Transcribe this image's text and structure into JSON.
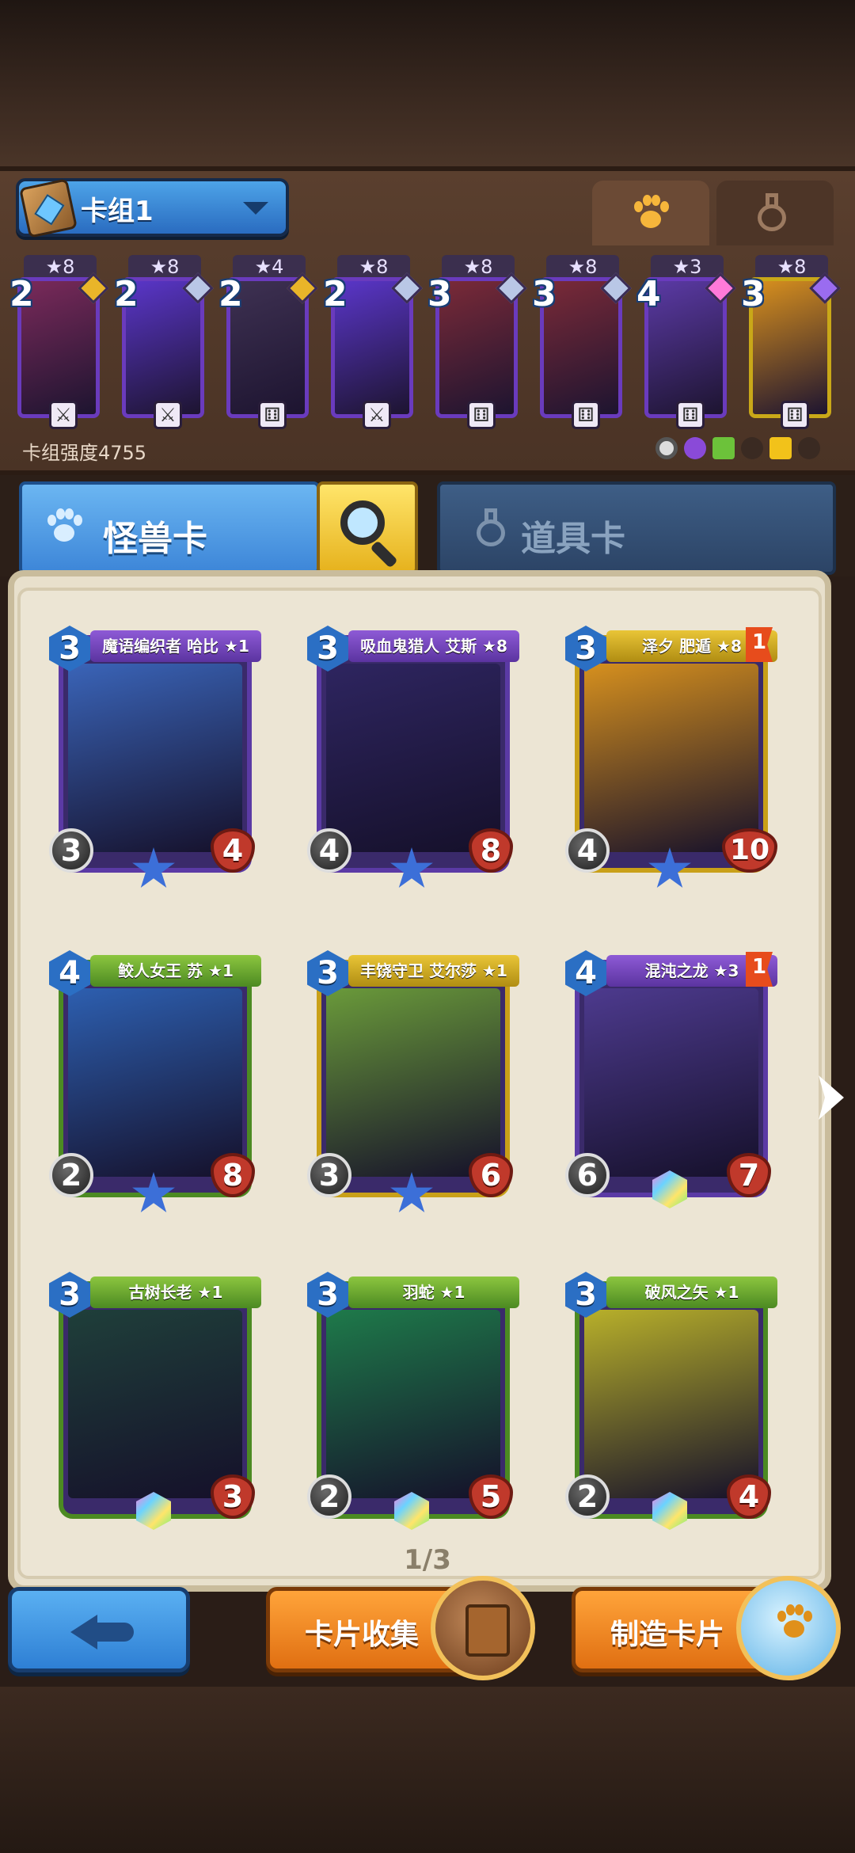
{
  "deck": {
    "name": "卡组1",
    "strength_label": "卡组强度4755",
    "cards": [
      {
        "cost": "2",
        "stars": "★8",
        "gem": "#e9b529",
        "bottom": "sword",
        "frame": "purple",
        "art": "#7a2a5a"
      },
      {
        "cost": "2",
        "stars": "★8",
        "gem": "#b9c7e6",
        "bottom": "sword",
        "frame": "purple",
        "art": "#5a36c9"
      },
      {
        "cost": "2",
        "stars": "★4",
        "gem": "#e9b529",
        "bottom": "dice",
        "frame": "purple",
        "art": "#3e3152"
      },
      {
        "cost": "2",
        "stars": "★8",
        "gem": "#b9c7e6",
        "bottom": "sword",
        "frame": "purple",
        "art": "#5a36c9"
      },
      {
        "cost": "3",
        "stars": "★8",
        "gem": "#b9c7e6",
        "bottom": "dice",
        "frame": "purple",
        "art": "#7a2a38"
      },
      {
        "cost": "3",
        "stars": "★8",
        "gem": "#b9c7e6",
        "bottom": "dice",
        "frame": "purple",
        "art": "#7a2a38"
      },
      {
        "cost": "4",
        "stars": "★3",
        "gem": "#ff7ad9",
        "bottom": "dice",
        "frame": "purple",
        "art": "#5b3aa5"
      },
      {
        "cost": "3",
        "stars": "★8",
        "gem": "#9a6cf0",
        "bottom": "dice",
        "frame": "gold",
        "art": "#d8901e"
      }
    ]
  },
  "tabs": {
    "monster": "怪兽卡",
    "item": "道具卡"
  },
  "collection": [
    {
      "name": "魔语编织者 哈比 ★1",
      "cost": "3",
      "atk": "3",
      "hp": "4",
      "color": "purple",
      "art": "#3a64b8",
      "badge": "star"
    },
    {
      "name": "吸血鬼猎人 艾斯 ★8",
      "cost": "3",
      "atk": "4",
      "hp": "8",
      "color": "purple",
      "art": "#2e2560",
      "badge": "star"
    },
    {
      "name": "泽夕 肥遁 ★8",
      "cost": "3",
      "atk": "4",
      "hp": "10",
      "color": "gold",
      "art": "#d6901e",
      "badge": "star",
      "flag": "1"
    },
    {
      "name": "鲛人女王 苏 ★1",
      "cost": "4",
      "atk": "2",
      "hp": "8",
      "color": "green",
      "art": "#2d5fb0",
      "badge": "star"
    },
    {
      "name": "丰饶守卫 艾尔莎 ★1",
      "cost": "3",
      "atk": "3",
      "hp": "6",
      "color": "gold",
      "art": "#6a9a3a",
      "badge": "star"
    },
    {
      "name": "混沌之龙 ★3",
      "cost": "4",
      "atk": "6",
      "hp": "7",
      "color": "purple",
      "art": "#4d3a8e",
      "badge": "gem",
      "flag": "1"
    },
    {
      "name": "古树长老 ★1",
      "cost": "3",
      "atk": "",
      "hp": "3",
      "color": "green",
      "art": "#1f3f3a",
      "badge": "gem"
    },
    {
      "name": "羽蛇 ★1",
      "cost": "3",
      "atk": "2",
      "hp": "5",
      "color": "green",
      "art": "#1e7a4a",
      "badge": "gem"
    },
    {
      "name": "破风之矢 ★1",
      "cost": "3",
      "atk": "2",
      "hp": "4",
      "color": "green",
      "art": "#b8b02a",
      "badge": "gem"
    }
  ],
  "page": "1/3",
  "buttons": {
    "collect": "卡片收集",
    "craft": "制造卡片"
  },
  "colors": {
    "accent_blue": "#3d86d8",
    "accent_orange": "#ff9a2e",
    "panel_brown": "#4a3325",
    "parchment": "#e8e0cc"
  }
}
